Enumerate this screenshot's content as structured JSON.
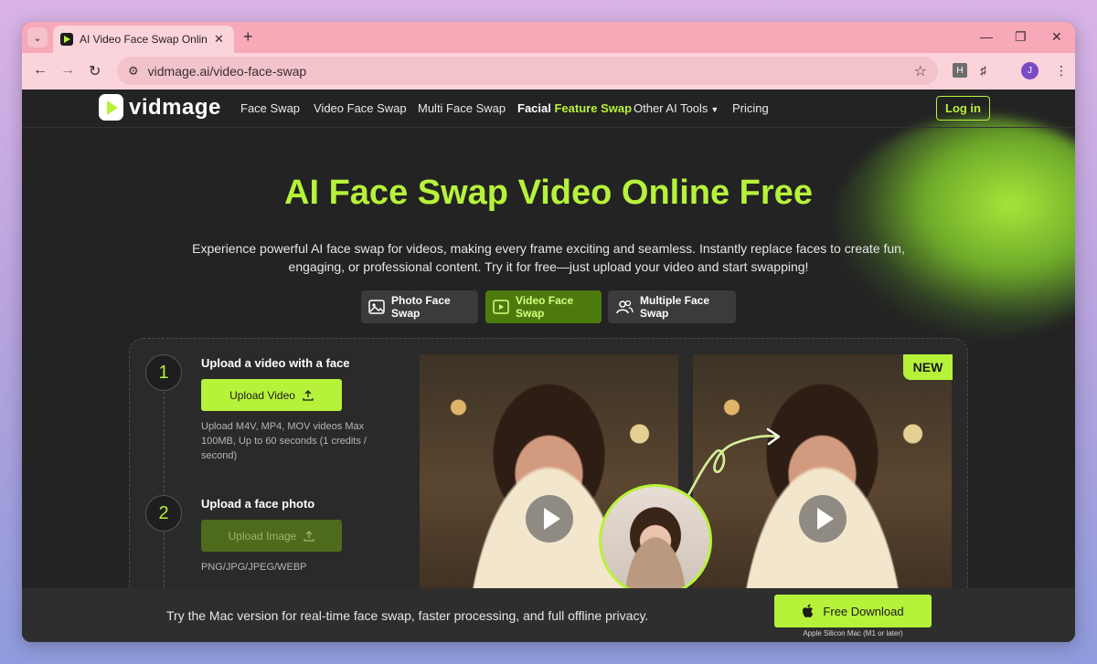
{
  "browser": {
    "tab_title": "AI Video Face Swap Online for F",
    "new_tab": "+",
    "url": "vidmage.ai/video-face-swap",
    "profile_initial": "J",
    "extension_letter": "H"
  },
  "nav": {
    "logo": "vidmage",
    "links": [
      "Face Swap",
      "Video Face Swap",
      "Multi Face Swap"
    ],
    "facial_feature_prefix": "Facial",
    "facial_feature_accent": "Feature",
    "facial_feature_suffix": "Swap",
    "other_tools": "Other AI Tools",
    "pricing": "Pricing",
    "login": "Log in"
  },
  "hero": {
    "title": "AI Face Swap Video Online Free",
    "subtitle": "Experience powerful AI face swap for videos, making every frame exciting and seamless. Instantly replace faces to create fun, engaging, or professional content. Try it for free—just upload your video and start swapping!"
  },
  "modes": [
    {
      "label": "Photo Face Swap",
      "icon": "image-icon",
      "active": false
    },
    {
      "label": "Video Face Swap",
      "icon": "video-play-icon",
      "active": true
    },
    {
      "label": "Multiple Face Swap",
      "icon": "users-icon",
      "active": false
    }
  ],
  "steps": [
    {
      "num": "1",
      "title": "Upload a video with a face",
      "button": "Upload Video",
      "note": "Upload M4V, MP4, MOV videos Max 100MB, Up to 60 seconds (1 credits / second)"
    },
    {
      "num": "2",
      "title": "Upload a face photo",
      "button": "Upload Image",
      "note": "PNG/JPG/JPEG/WEBP"
    }
  ],
  "preview": {
    "badge": "NEW"
  },
  "footer": {
    "text": "Try the Mac version for real-time face swap, faster processing, and full offline privacy.",
    "download_label": "Free Download",
    "download_sub": "Apple Silicon Mac (M1 or later)"
  },
  "colors": {
    "accent": "#b7f23a",
    "background": "#232323",
    "active_mode": "#4d7a0d"
  }
}
